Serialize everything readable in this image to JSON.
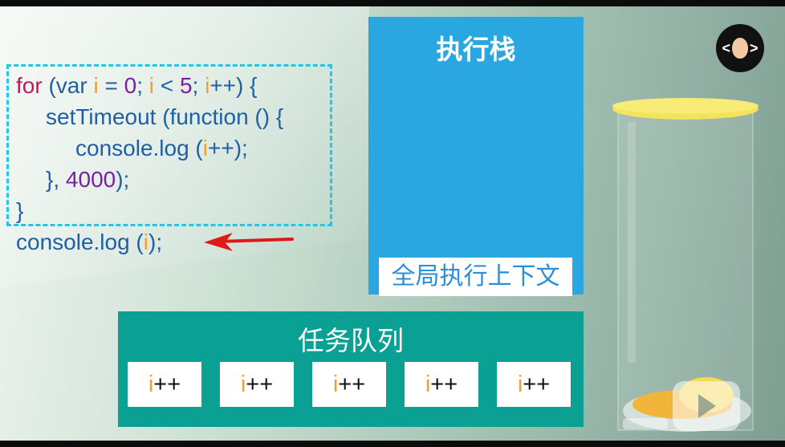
{
  "code": {
    "line1": {
      "kw_for": "for",
      "p1": " (",
      "kw_var": "var",
      "sp1": " ",
      "v1": "i",
      "p2": " = ",
      "n0": "0",
      "p3": "; ",
      "v2": "i",
      "p4": " < ",
      "n5": "5",
      "p5": "; ",
      "v3": "i",
      "p6": "++) {"
    },
    "line2": {
      "fn1": "setTimeout",
      "p1": " (",
      "kw_function": "function",
      "p2": " () {"
    },
    "line3": {
      "fn1": "console.log",
      "p1": " (",
      "v1": "i",
      "p2": "++);"
    },
    "line4": {
      "p1": "}, ",
      "n1": "4000",
      "p2": ");"
    },
    "line5": {
      "p1": "}"
    },
    "line6": {
      "fn1": "console.log",
      "p1": " (",
      "v1": "i",
      "p2": ");"
    }
  },
  "exec_stack": {
    "title": "执行栈",
    "global_context": "全局执行上下文"
  },
  "task_queue": {
    "title": "任务队列",
    "tasks": [
      {
        "var": "i",
        "op": "++"
      },
      {
        "var": "i",
        "op": "++"
      },
      {
        "var": "i",
        "op": "++"
      },
      {
        "var": "i",
        "op": "++"
      },
      {
        "var": "i",
        "op": "++"
      }
    ]
  },
  "logo": {
    "left": "<",
    "right": ">"
  },
  "colors": {
    "keyword": "#c2185b",
    "number": "#7b1fa2",
    "variable": "#f0a030",
    "code_text": "#1f5fa6",
    "exec_stack_bg": "#2aa7e1",
    "task_queue_bg": "#0aa094",
    "dashed_border": "#1ec8e6",
    "arrow": "#e01818"
  },
  "icons": [
    "red-arrow-icon",
    "channel-logo-icon",
    "glass-jar-icon",
    "watermark-icon"
  ]
}
